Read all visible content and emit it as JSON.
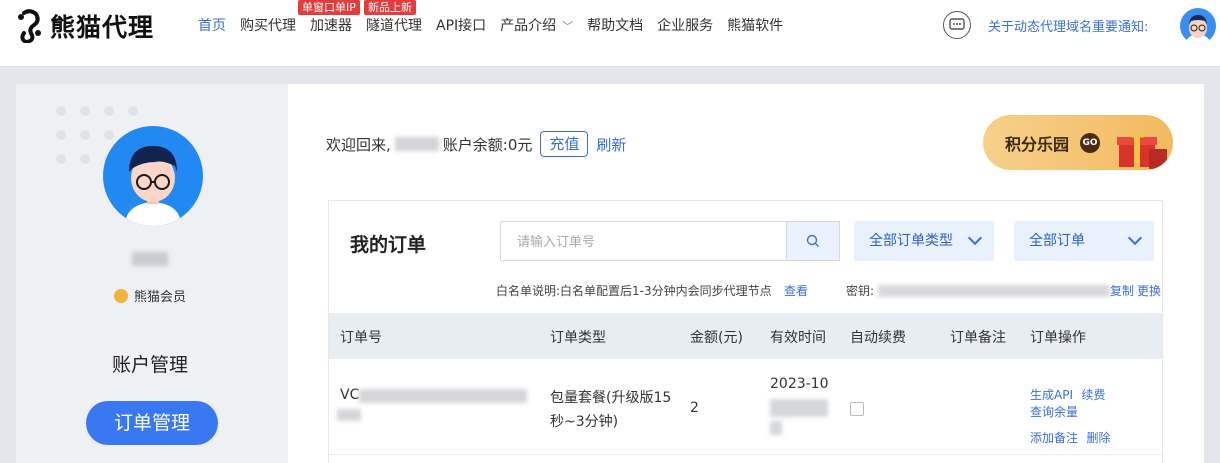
{
  "nav": {
    "brand": "熊猫代理",
    "items": [
      {
        "label": "首页",
        "active": true
      },
      {
        "label": "购买代理"
      },
      {
        "label": "加速器",
        "badge": "单窗口单IP"
      },
      {
        "label": "隧道代理",
        "badge": "新品上新"
      },
      {
        "label": "API接口"
      },
      {
        "label": "产品介绍",
        "dropdown": true
      },
      {
        "label": "帮助文档"
      },
      {
        "label": "企业服务"
      },
      {
        "label": "熊猫软件"
      }
    ],
    "notice": "关于动态代理域名重要通知:"
  },
  "sidebar": {
    "member_label": "熊猫会员",
    "account_management": "账户管理",
    "order_management": "订单管理"
  },
  "welcome": {
    "prefix": "欢迎回来,",
    "balance_label": "账户余额:",
    "balance_value": "0元",
    "recharge": "充值",
    "refresh": "刷新"
  },
  "points": {
    "label": "积分乐园",
    "go": "GO"
  },
  "orders": {
    "title": "我的订单",
    "search_placeholder": "请输入订单号",
    "type_filter": "全部订单类型",
    "status_filter": "全部订单",
    "whitelist_note": "白名单说明:白名单配置后1-3分钟内会同步代理节点",
    "view": "查看",
    "secret_label": "密钥:",
    "copy": "复制",
    "change": "更换",
    "columns": [
      "订单号",
      "订单类型",
      "金额(元)",
      "有效时间",
      "自动续费",
      "订单备注",
      "订单操作"
    ],
    "rows": [
      {
        "order_prefix": "VC",
        "type_line1": "包量套餐(升级版15",
        "type_line2": "秒~3分钟)",
        "amount": "2",
        "valid_time": "2023-10",
        "actions": [
          "生成API",
          "续费",
          "查询余量",
          "添加备注",
          "删除"
        ]
      }
    ]
  },
  "colors": {
    "accent": "#3b6fd9",
    "button": "#3a78f2",
    "badge": "#e23c3c"
  }
}
